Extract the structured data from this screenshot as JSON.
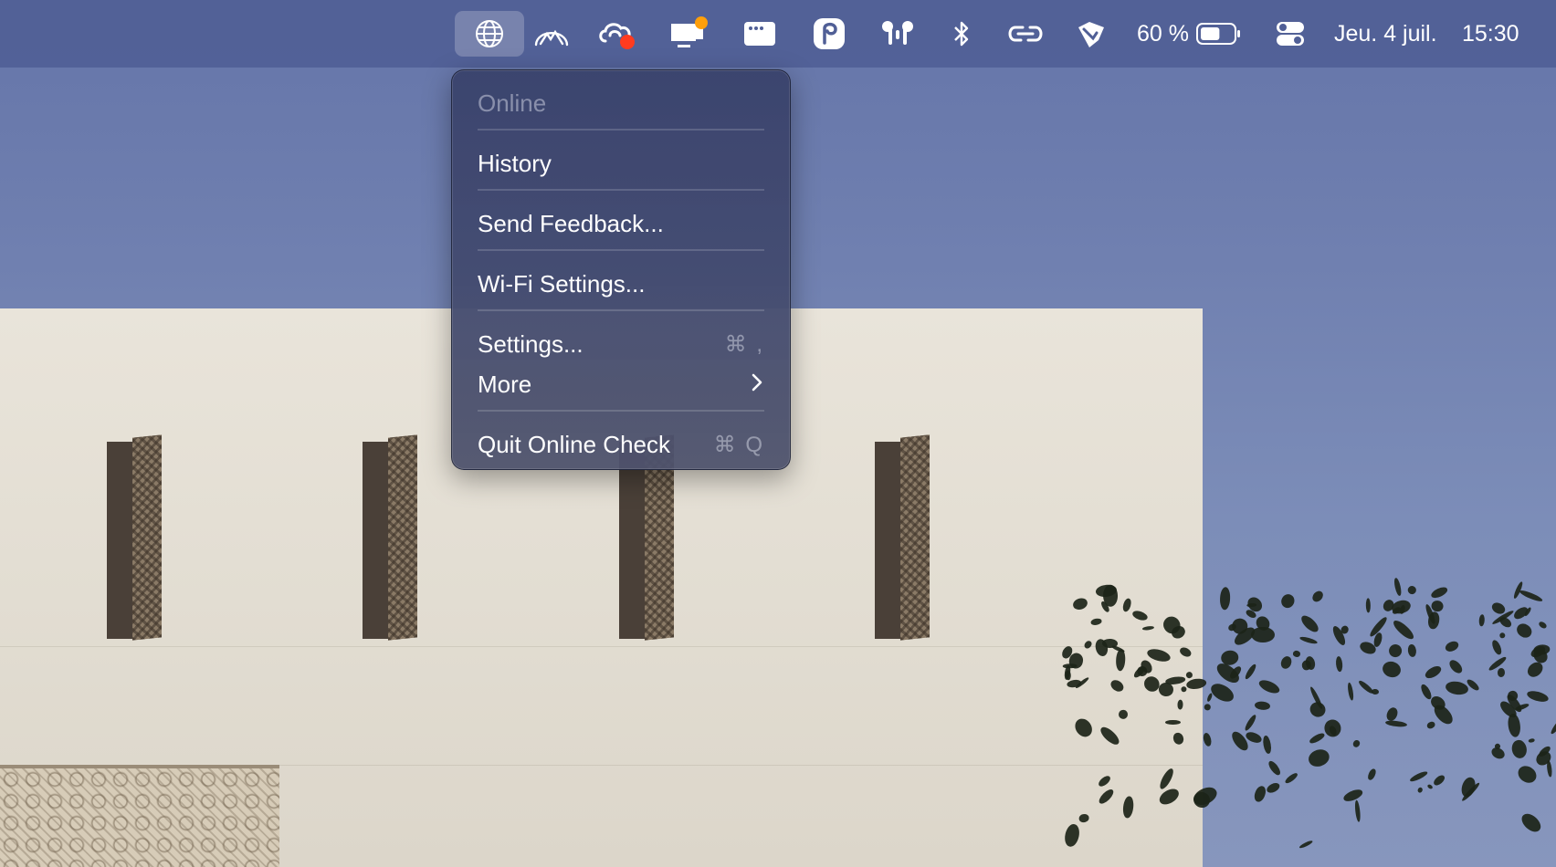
{
  "menubar": {
    "icons": [
      {
        "name": "globe-icon",
        "active": true
      },
      {
        "name": "mountain-arc-icon"
      },
      {
        "name": "creative-cloud-icon",
        "badge_color": "#ff3b1f"
      },
      {
        "name": "notification-presenter-icon",
        "badge_color": "#ff9f0a"
      },
      {
        "name": "window-bar-icon"
      },
      {
        "name": "app-p-icon"
      },
      {
        "name": "airpods-icon"
      },
      {
        "name": "bluetooth-icon"
      },
      {
        "name": "link-icon"
      },
      {
        "name": "pin-shield-icon"
      },
      {
        "name": "battery-icon"
      },
      {
        "name": "control-center-icon"
      }
    ],
    "battery_percent_label": "60 %",
    "battery_level": 0.6,
    "date": "Jeu. 4 juil.",
    "time": "15:30"
  },
  "menu": {
    "status_label": "Online",
    "items": [
      {
        "label": "History"
      },
      {
        "label": "Send Feedback..."
      },
      {
        "label": "Wi-Fi Settings..."
      },
      {
        "label": "Settings...",
        "shortcut": "⌘ ,"
      },
      {
        "label": "More",
        "submenu_icon": "chevron-right-icon"
      },
      {
        "label": "Quit Online Check",
        "shortcut": "⌘ Q"
      }
    ]
  },
  "colors": {
    "menubar_bg": "#505f96",
    "menu_bg": "#3a436c",
    "accent_red": "#ff3b1f",
    "accent_orange": "#ff9f0a"
  }
}
